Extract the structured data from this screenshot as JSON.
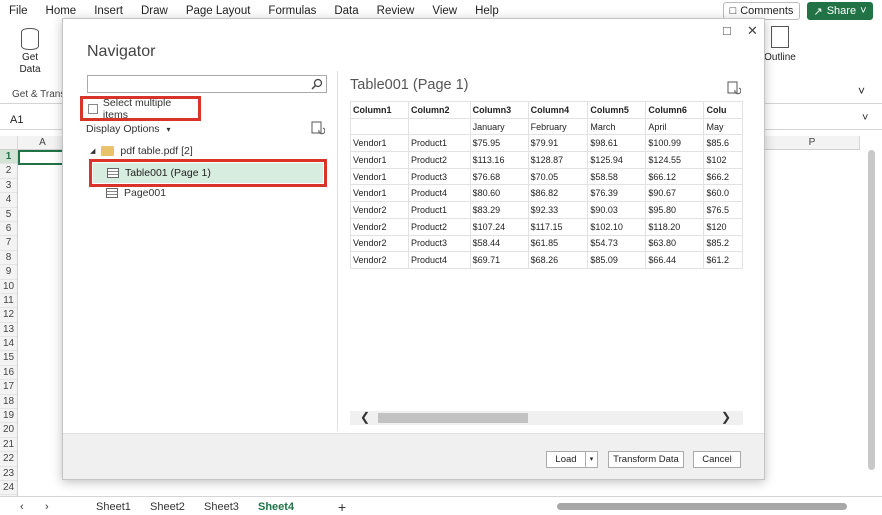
{
  "excel": {
    "menu": [
      "File",
      "Home",
      "Insert",
      "Draw",
      "Page Layout",
      "Formulas",
      "Data",
      "Review",
      "View",
      "Help"
    ],
    "comments_label": "Comments",
    "share_label": "Share",
    "ribbon": {
      "get_data_label": "Get Data",
      "group_label": "Get & Transf",
      "outline_label": "Outline"
    },
    "name_box": "A1",
    "col_a": "A",
    "col_p": "P",
    "rows": [
      "1",
      "2",
      "3",
      "4",
      "5",
      "6",
      "7",
      "8",
      "9",
      "10",
      "11",
      "12",
      "13",
      "14",
      "15",
      "16",
      "17",
      "18",
      "19",
      "20",
      "21",
      "22",
      "23",
      "24"
    ],
    "sheets": [
      "Sheet1",
      "Sheet2",
      "Sheet3",
      "Sheet4"
    ],
    "active_sheet": "Sheet4",
    "add_sheet": "+"
  },
  "navigator": {
    "title": "Navigator",
    "search_placeholder": "",
    "select_multiple_label": "Select multiple items",
    "select_multiple_checked": false,
    "display_options_label": "Display Options",
    "tree": {
      "file_label": "pdf table.pdf [2]",
      "items": [
        {
          "label": "Table001 (Page 1)",
          "selected": true
        },
        {
          "label": "Page001",
          "selected": false
        }
      ]
    },
    "preview": {
      "title": "Table001 (Page 1)",
      "columns": [
        "Column1",
        "Column2",
        "Column3",
        "Column4",
        "Column5",
        "Column6",
        "Colu"
      ],
      "rows": [
        [
          "",
          "",
          "January",
          "February",
          "March",
          "April",
          "May"
        ],
        [
          "Vendor1",
          "Product1",
          "$75.95",
          "$79.91",
          "$98.61",
          "$100.99",
          "$85.6"
        ],
        [
          "Vendor1",
          "Product2",
          "$113.16",
          "$128.87",
          "$125.94",
          "$124.55",
          "$102"
        ],
        [
          "Vendor1",
          "Product3",
          "$76.68",
          "$70.05",
          "$58.58",
          "$66.12",
          "$66.2"
        ],
        [
          "Vendor1",
          "Product4",
          "$80.60",
          "$86.82",
          "$76.39",
          "$90.67",
          "$60.0"
        ],
        [
          "Vendor2",
          "Product1",
          "$83.29",
          "$92.33",
          "$90.03",
          "$95.80",
          "$76.5"
        ],
        [
          "Vendor2",
          "Product2",
          "$107.24",
          "$117.15",
          "$102.10",
          "$118.20",
          "$120"
        ],
        [
          "Vendor2",
          "Product3",
          "$58.44",
          "$61.85",
          "$54.73",
          "$63.80",
          "$85.2"
        ],
        [
          "Vendor2",
          "Product4",
          "$69.71",
          "$68.26",
          "$85.09",
          "$66.44",
          "$61.2"
        ]
      ]
    },
    "buttons": {
      "load": "Load",
      "transform": "Transform Data",
      "cancel": "Cancel"
    },
    "highlight_color": "#d8342a",
    "selected_bg": "#d7ede0"
  }
}
